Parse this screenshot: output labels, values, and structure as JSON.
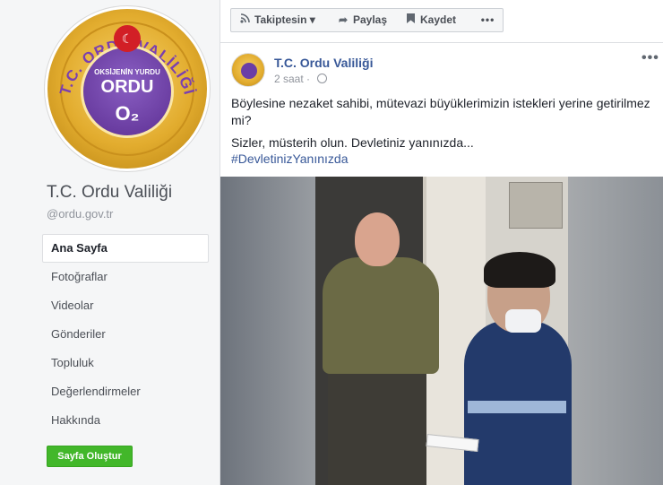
{
  "sidebar": {
    "logo": {
      "arc_text": "T.C. ORDU VALİLİĞİ",
      "tagline": "OKSİJENİN YURDU",
      "city": "ORDU",
      "symbol": "O₂"
    },
    "page_name": "T.C. Ordu Valiliği",
    "handle": "@ordu.gov.tr",
    "nav": [
      {
        "label": "Ana Sayfa",
        "active": true
      },
      {
        "label": "Fotoğraflar",
        "active": false
      },
      {
        "label": "Videolar",
        "active": false
      },
      {
        "label": "Gönderiler",
        "active": false
      },
      {
        "label": "Topluluk",
        "active": false
      },
      {
        "label": "Değerlendirmeler",
        "active": false
      },
      {
        "label": "Hakkında",
        "active": false
      }
    ],
    "create_page_label": "Sayfa Oluştur"
  },
  "action_bar": {
    "follow_label": "Takiptesin",
    "follow_icon": "rss-icon",
    "share_label": "Paylaş",
    "share_icon": "share-arrow-icon",
    "save_label": "Kaydet",
    "save_icon": "bookmark-icon",
    "more_label": "•••"
  },
  "post": {
    "author": "T.C. Ordu Valiliği",
    "time": "2 saat",
    "privacy_icon": "globe-icon",
    "options_label": "•••",
    "text_line1": "Böylesine nezaket sahibi, mütevazi büyüklerimizin istekleri yerine getirilmez mi?",
    "text_line2": "Sizler, müsterih olun. Devletiniz yanınızda...",
    "hashtag": "#DevletinizYanınızda"
  },
  "colors": {
    "brand_blue": "#385898",
    "green_button": "#42b72a",
    "background": "#e9ebee"
  }
}
